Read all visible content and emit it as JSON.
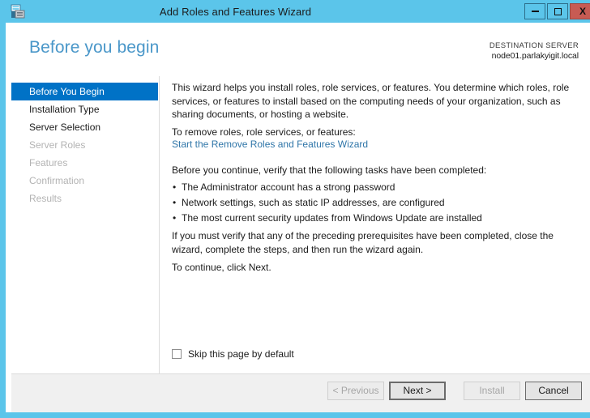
{
  "desktop": {
    "strip_color": "#78b4d8",
    "accent_red": "#c1272d"
  },
  "window": {
    "title": "Add Roles and Features Wizard",
    "icon": "server-manager-icon",
    "frame_color": "#5bc5ea",
    "controls": {
      "minimize": "minimize-icon",
      "maximize": "maximize-icon",
      "close_label": "X"
    }
  },
  "header": {
    "page_title": "Before you begin",
    "destination_label": "DESTINATION SERVER",
    "destination_value": "node01.parlakyigit.local",
    "title_color": "#4a97c9"
  },
  "sidebar": {
    "items": [
      {
        "label": "Before You Begin",
        "state": "selected"
      },
      {
        "label": "Installation Type",
        "state": "enabled"
      },
      {
        "label": "Server Selection",
        "state": "enabled"
      },
      {
        "label": "Server Roles",
        "state": "disabled"
      },
      {
        "label": "Features",
        "state": "disabled"
      },
      {
        "label": "Confirmation",
        "state": "disabled"
      },
      {
        "label": "Results",
        "state": "disabled"
      }
    ],
    "selected_color": "#0072c6",
    "disabled_color": "#b3b3b3"
  },
  "content": {
    "intro": "This wizard helps you install roles, role services, or features. You determine which roles, role services, or features to install based on the computing needs of your organization, such as sharing documents, or hosting a website.",
    "remove_label": "To remove roles, role services, or features:",
    "remove_link": "Start the Remove Roles and Features Wizard",
    "link_color": "#2e75a8",
    "verify_label": "Before you continue, verify that the following tasks have been completed:",
    "bullets": [
      "The Administrator account has a strong password",
      "Network settings, such as static IP addresses, are configured",
      "The most current security updates from Windows Update are installed"
    ],
    "close_note": "If you must verify that any of the preceding prerequisites have been completed, close the wizard, complete the steps, and then run the wizard again.",
    "continue_note": "To continue, click Next.",
    "skip_checkbox_label": "Skip this page by default",
    "skip_checkbox_checked": false
  },
  "footer": {
    "buttons": [
      {
        "label": "< Previous",
        "state": "disabled"
      },
      {
        "label": "Next >",
        "state": "default"
      },
      {
        "label": "Install",
        "state": "disabled"
      },
      {
        "label": "Cancel",
        "state": "enabled"
      }
    ]
  }
}
